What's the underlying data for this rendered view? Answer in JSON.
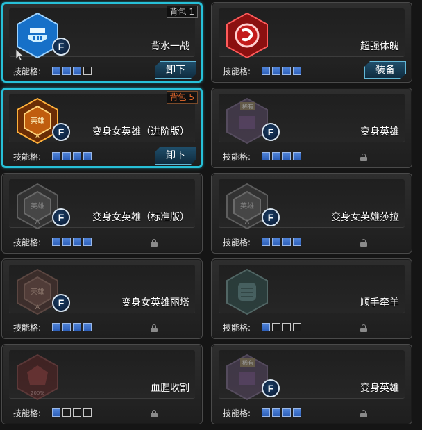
{
  "colors": {
    "equipped_border": "#27c0d8",
    "slot_filled": "#3e72c8",
    "pack_tag_orange": "#e2682c"
  },
  "cards": [
    {
      "name": "背水一战",
      "slot_label": "技能格:",
      "slots_filled": 3,
      "slots_total": 4,
      "badge": "F",
      "icon": "blue-shield-crown-icon",
      "equipped": true,
      "pack_tag": "背包 1",
      "action": "卸下",
      "locked": false
    },
    {
      "name": "超强体魄",
      "slot_label": "技能格:",
      "slots_filled": 4,
      "slots_total": 4,
      "badge": "",
      "icon": "red-circle-emblem-icon",
      "equipped": false,
      "pack_tag": "",
      "action": "装备",
      "locked": false
    },
    {
      "name": "变身女英雄（进阶版）",
      "slot_label": "技能格:",
      "slots_filled": 4,
      "slots_total": 4,
      "badge": "F",
      "icon": "gold-hero-hexagon-icon",
      "icon_text": "英雄",
      "equipped": true,
      "pack_tag": "背包 5",
      "action": "卸下",
      "locked": false
    },
    {
      "name": "变身英雄",
      "slot_label": "技能格:",
      "slots_filled": 4,
      "slots_total": 4,
      "badge": "F",
      "icon": "faded-rare-hexagon-icon",
      "icon_text": "稀有",
      "equipped": false,
      "pack_tag": "",
      "action": "",
      "locked": true
    },
    {
      "name": "变身女英雄（标准版）",
      "slot_label": "技能格:",
      "slots_filled": 4,
      "slots_total": 4,
      "badge": "F",
      "icon": "gray-hero-hexagon-icon",
      "icon_text": "英雄",
      "equipped": false,
      "pack_tag": "",
      "action": "",
      "locked": true
    },
    {
      "name": "变身女英雄莎拉",
      "slot_label": "技能格:",
      "slots_filled": 4,
      "slots_total": 4,
      "badge": "F",
      "icon": "gray-hero-hexagon-icon",
      "icon_text": "英雄",
      "equipped": false,
      "pack_tag": "",
      "action": "",
      "locked": true
    },
    {
      "name": "变身女英雄丽塔",
      "slot_label": "技能格:",
      "slots_filled": 4,
      "slots_total": 4,
      "badge": "F",
      "icon": "faded-hero-hexagon-icon",
      "icon_text": "英雄",
      "equipped": false,
      "pack_tag": "",
      "action": "",
      "locked": true
    },
    {
      "name": "顺手牵羊",
      "slot_label": "技能格:",
      "slots_filled": 1,
      "slots_total": 4,
      "badge": "",
      "icon": "faded-fist-hexagon-icon",
      "equipped": false,
      "pack_tag": "",
      "action": "",
      "locked": true
    },
    {
      "name": "血腥收割",
      "slot_label": "技能格:",
      "slots_filled": 1,
      "slots_total": 4,
      "badge": "",
      "icon": "faded-red-hexagon-icon",
      "icon_text": "200%",
      "equipped": false,
      "pack_tag": "",
      "action": "",
      "locked": true
    },
    {
      "name": "变身英雄",
      "slot_label": "技能格:",
      "slots_filled": 4,
      "slots_total": 4,
      "badge": "F",
      "icon": "faded-rare-hexagon-icon",
      "icon_text": "稀有",
      "equipped": false,
      "pack_tag": "",
      "action": "",
      "locked": true
    }
  ]
}
